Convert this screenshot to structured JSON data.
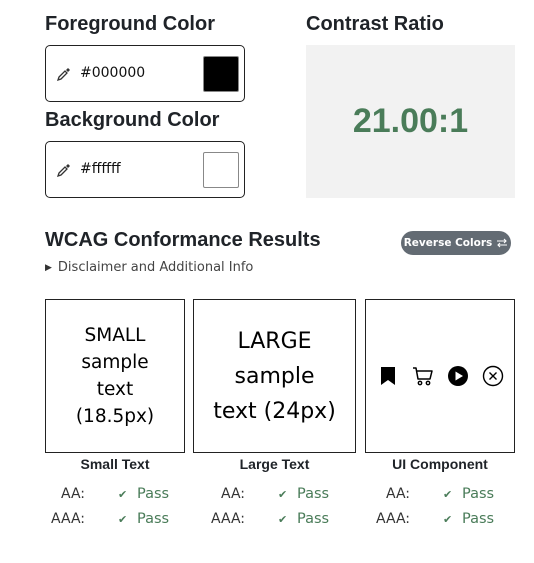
{
  "foreground": {
    "title": "Foreground Color",
    "value": "#000000",
    "swatch_color": "#000000"
  },
  "background": {
    "title": "Background Color",
    "value": "#ffffff",
    "swatch_color": "#ffffff"
  },
  "contrast": {
    "title": "Contrast Ratio",
    "value": "21.00:1",
    "color": "#4a7c59"
  },
  "wcag": {
    "title": "WCAG Conformance Results",
    "reverse_label": "Reverse Colors",
    "disclaimer": "Disclaimer and Additional Info"
  },
  "samples": {
    "small_lines": [
      "SMALL",
      "sample",
      "text",
      "(18.5px)"
    ],
    "large_lines": [
      "LARGE",
      "sample",
      "text (24px)"
    ]
  },
  "ui_icons": [
    "bookmark-icon",
    "cart-icon",
    "play-circle-icon",
    "close-circle-icon"
  ],
  "results": [
    {
      "title": "Small Text",
      "aa_label": "AA:",
      "aa": "Pass",
      "aaa_label": "AAA:",
      "aaa": "Pass"
    },
    {
      "title": "Large Text",
      "aa_label": "AA:",
      "aa": "Pass",
      "aaa_label": "AAA:",
      "aaa": "Pass"
    },
    {
      "title": "UI Component",
      "aa_label": "AA:",
      "aa": "Pass",
      "aaa_label": "AAA:",
      "aaa": "Pass"
    }
  ],
  "colors": {
    "pass": "#4a7c59",
    "button_bg": "#636b73",
    "panel_bg": "#f2f2f2"
  }
}
